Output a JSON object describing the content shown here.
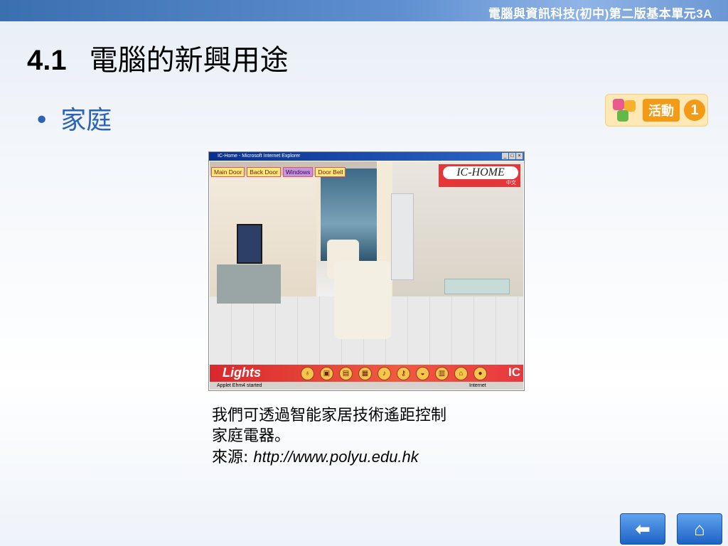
{
  "header": {
    "course_title": "電腦與資訊科技(初中)第二版基本單元3A"
  },
  "slide": {
    "number": "4.1",
    "title": "電腦的新興用途",
    "bullet": "家庭"
  },
  "activity_badge": {
    "label": "活動",
    "number": "1"
  },
  "screenshot": {
    "window_title": "IC-Home - Microsoft Internet Explorer",
    "nav_buttons": [
      "Main Door",
      "Back Door",
      "Windows",
      "Door Bell"
    ],
    "logo_text": "IC-HOME",
    "logo_sub": "中文",
    "bottom_label": "Lights",
    "bottom_brand": "IC",
    "status_left": "Applet Ehm4 started",
    "status_right": "Internet"
  },
  "caption": {
    "line1": "我們可透過智能家居技術遙距控制",
    "line2": "家庭電器。",
    "source_label": "來源",
    "source_url": "http://www.polyu.edu.hk"
  },
  "nav": {
    "back_icon": "back-arrow-icon",
    "home_icon": "home-icon"
  },
  "colors": {
    "accent_blue": "#2a63b8",
    "badge_orange": "#f39a17",
    "ic_red": "#e7363a"
  }
}
